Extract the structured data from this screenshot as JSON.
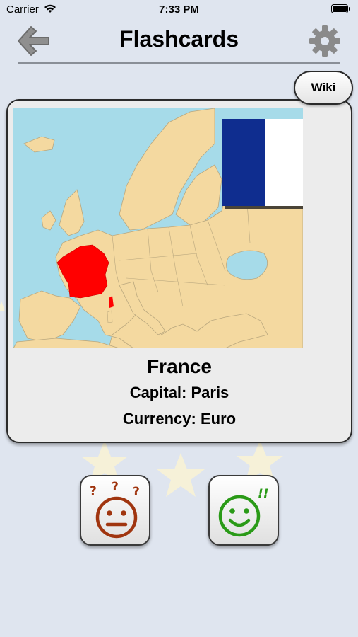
{
  "status_bar": {
    "carrier": "Carrier",
    "time": "7:33 PM"
  },
  "nav": {
    "title": "Flashcards",
    "back_icon": "arrow-left-icon",
    "settings_icon": "gear-icon"
  },
  "card": {
    "wiki_label": "Wiki",
    "country": "France",
    "capital": "Capital: Paris",
    "currency": "Currency: Euro",
    "highlight_color": "#ff0000",
    "flag_colors": [
      "#0f2d8f",
      "#ffffff",
      "#ee2a3a"
    ]
  },
  "answers": {
    "dont_know_icon": "confused-face-icon",
    "know_icon": "happy-face-icon"
  }
}
